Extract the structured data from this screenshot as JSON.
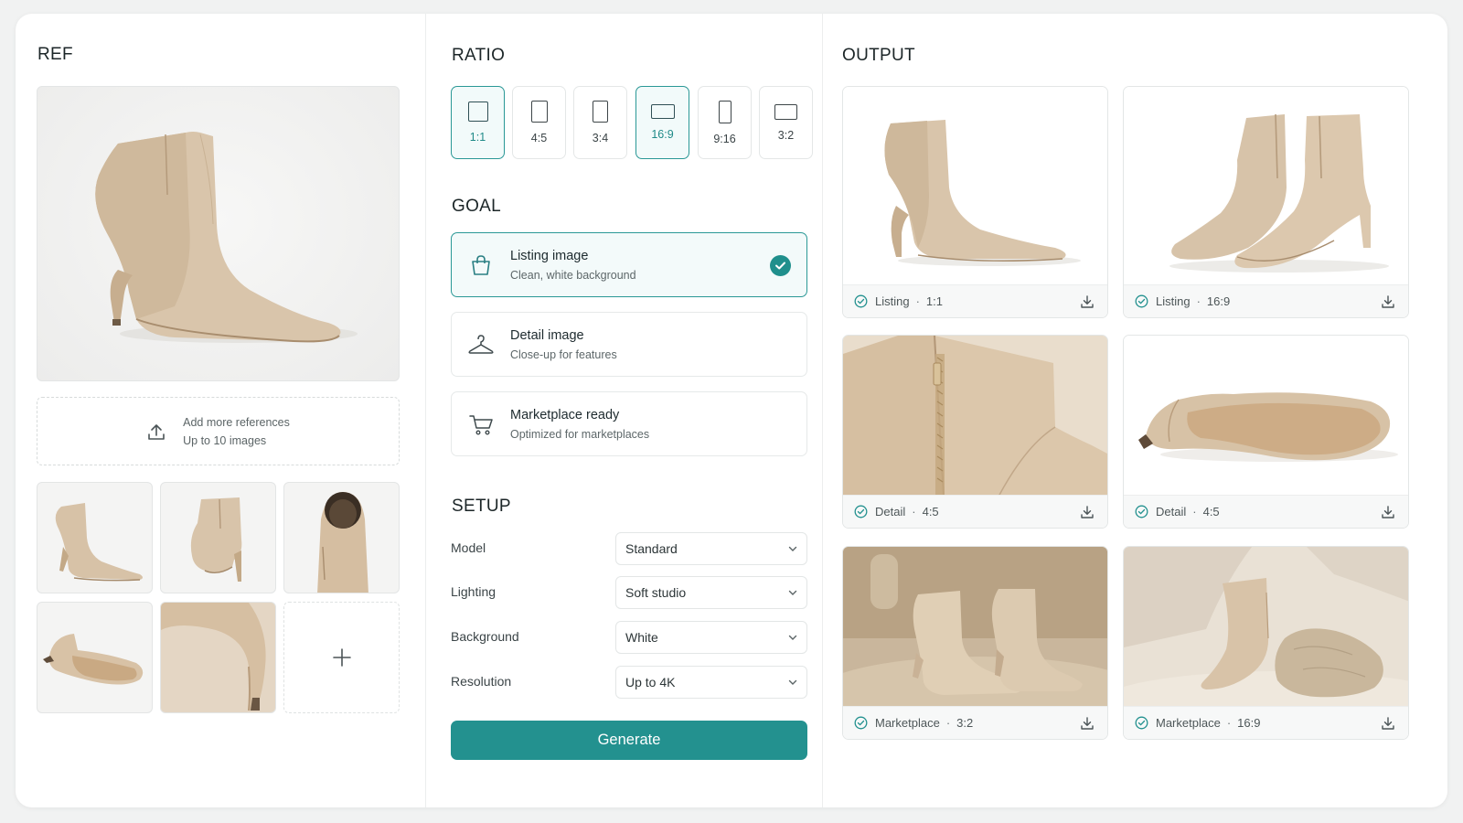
{
  "ref": {
    "title": "REF",
    "add_more": {
      "line1": "Add more references",
      "line2": "Up to 10 images"
    }
  },
  "ratio": {
    "title": "RATIO",
    "options": [
      {
        "label": "1:1",
        "selected": true
      },
      {
        "label": "4:5",
        "selected": false
      },
      {
        "label": "3:4",
        "selected": false
      },
      {
        "label": "16:9",
        "selected": true
      },
      {
        "label": "9:16",
        "selected": false
      },
      {
        "label": "3:2",
        "selected": false
      }
    ]
  },
  "goal": {
    "title": "GOAL",
    "options": [
      {
        "title": "Listing image",
        "subtitle": "Clean, white background",
        "icon": "shopping-bag-icon",
        "selected": true
      },
      {
        "title": "Detail image",
        "subtitle": "Close-up for features",
        "icon": "hanger-icon",
        "selected": false
      },
      {
        "title": "Marketplace ready",
        "subtitle": "Optimized for marketplaces",
        "icon": "cart-icon",
        "selected": false
      }
    ]
  },
  "setup": {
    "title": "SETUP",
    "rows": [
      {
        "label": "Model",
        "value": "Standard"
      },
      {
        "label": "Lighting",
        "value": "Soft studio"
      },
      {
        "label": "Background",
        "value": "White"
      },
      {
        "label": "Resolution",
        "value": "Up to 4K"
      }
    ],
    "generate_label": "Generate"
  },
  "output": {
    "title": "OUTPUT",
    "items": [
      {
        "type": "Listing",
        "ratio": "1:1"
      },
      {
        "type": "Listing",
        "ratio": "16:9"
      },
      {
        "type": "Detail",
        "ratio": "4:5"
      },
      {
        "type": "Detail",
        "ratio": "4:5"
      },
      {
        "type": "Marketplace",
        "ratio": "3:2"
      },
      {
        "type": "Marketplace",
        "ratio": "16:9"
      }
    ],
    "separator": "·"
  },
  "colors": {
    "accent": "#23918f",
    "accent_light": "#f2fafa",
    "boot": "#d8c3a8",
    "boot_shadow": "#b89c7c"
  }
}
